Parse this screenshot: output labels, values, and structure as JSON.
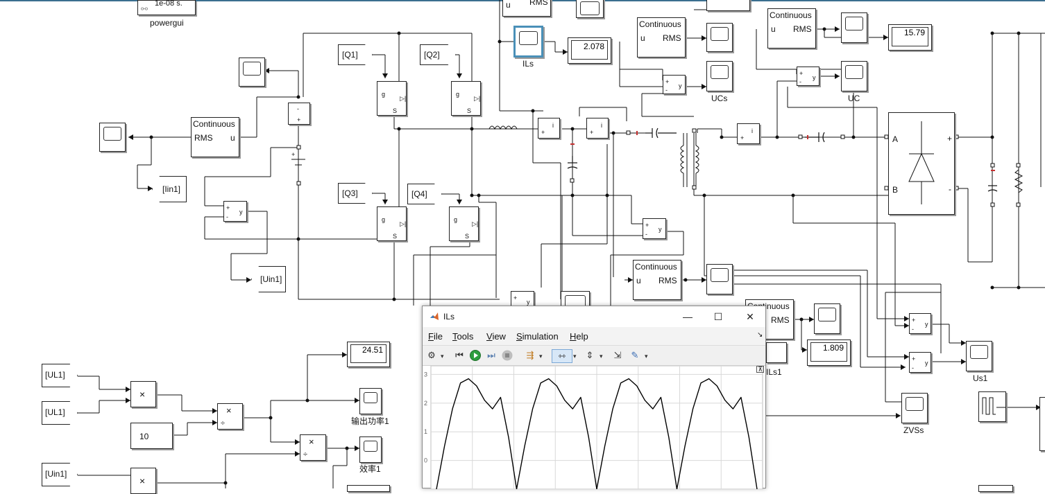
{
  "powergui": {
    "timestep": "1e-08 s.",
    "label": "powergui"
  },
  "rms_blocks": [
    {
      "id": "rms_in",
      "title": "Continuous",
      "in": "u",
      "out": "RMS"
    },
    {
      "id": "rms_left",
      "title": "Continuous",
      "in": "RMS",
      "out": "u"
    },
    {
      "id": "rms_top_a",
      "title": "",
      "in": "u",
      "out": "RMS"
    },
    {
      "id": "rms_uc",
      "title": "Continuous",
      "in": "u",
      "out": "RMS"
    },
    {
      "id": "rms_uc2",
      "title": "Continuous",
      "in": "u",
      "out": "RMS"
    },
    {
      "id": "rms_mid",
      "title": "Continuous",
      "in": "u",
      "out": "RMS"
    },
    {
      "id": "rms_right",
      "title": "Continuous",
      "in": "",
      "out": "RMS"
    }
  ],
  "displays": {
    "ils_rms": "2.078",
    "uc_rms": "15.79",
    "output_power": "24.51",
    "ils1_rms": "1.809"
  },
  "scope_labels": {
    "ils": "ILs",
    "ucs": "UCs",
    "uc": "UC",
    "us1": "Us1",
    "zvss": "ZVSs",
    "power": "输出功率1",
    "efficiency": "效率1",
    "ils1": "ILs1"
  },
  "goto_tags": {
    "q1": "[Q1]",
    "q2": "[Q2]",
    "q3": "[Q3]",
    "q4": "[Q4]",
    "iin1": "[Iin1]",
    "uin1": "[Uin1]",
    "ul1_a": "[UL1]",
    "ul1_b": "[UL1]",
    "uin1_b": "[Uin1]"
  },
  "constant": "10",
  "product_sign": "×",
  "divide_sign": "÷",
  "rectifier_ports": {
    "a": "A",
    "b": "B",
    "plus": "+",
    "minus": "-"
  },
  "window": {
    "title": "ILs",
    "menus": [
      "File",
      "Tools",
      "View",
      "Simulation",
      "Help"
    ],
    "menu_keys": [
      "F",
      "T",
      "V",
      "S",
      "H"
    ],
    "controls": {
      "minimize": "—",
      "maximize": "☐",
      "close": "✕"
    },
    "toolbar_icons": [
      "settings-icon",
      "rewind-icon",
      "run-icon",
      "step-forward-icon",
      "stop-icon",
      "signal-select-icon",
      "zoom-icon",
      "autoscale-icon",
      "dock-icon",
      "edit-icon"
    ],
    "yticks": [
      "3",
      "2",
      "1",
      "0"
    ]
  },
  "chart_data": {
    "type": "line",
    "title": "",
    "xlabel": "",
    "ylabel": "",
    "ylim": [
      -1,
      3.3
    ],
    "ytick_labels": [
      "3",
      "2",
      "1",
      "0"
    ],
    "grid": true,
    "series": [
      {
        "values": [
          -1.0,
          0.5,
          1.8,
          2.7,
          2.85,
          2.6,
          2.1,
          1.8,
          2.2,
          0.8,
          -1.0,
          0.5,
          1.8,
          2.7,
          2.85,
          2.6,
          2.1,
          1.8,
          2.2,
          0.8,
          -1.0,
          0.5,
          1.8,
          2.7,
          2.85,
          2.6,
          2.1,
          1.8,
          2.2,
          0.8,
          -1.0,
          0.5,
          1.8,
          2.7,
          2.85,
          2.6,
          2.1,
          1.8,
          2.2,
          0.8,
          -1.0
        ]
      }
    ],
    "colors": {
      "line": "#000000",
      "grid": "#d8d8d8"
    }
  }
}
